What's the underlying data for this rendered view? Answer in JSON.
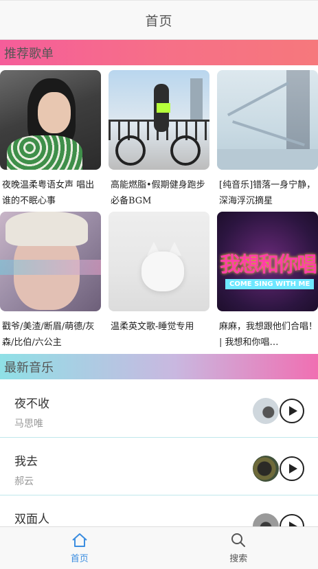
{
  "header": {
    "title": "首页"
  },
  "sections": {
    "recommend_title": "推荐歌单",
    "latest_title": "最新音乐"
  },
  "playlists": [
    {
      "title": "夜晚温柔粤语女声 唱出谁的不眠心事"
    },
    {
      "title": "高能燃脂•假期健身跑步必备BGM"
    },
    {
      "title": "[纯音乐]错落一身宁静，深海浮沉摘星"
    },
    {
      "title": "戳爷/美渣/断眉/萌德/灰森/比伯/六公主"
    },
    {
      "title": "温柔英文歌-睡觉专用"
    },
    {
      "title": "麻麻，我想跟他们合唱！|  我想和你唱…"
    }
  ],
  "cover_text": {
    "sing_title": "我想和你唱",
    "sing_subtitle": "COME SING WITH ME"
  },
  "songs": [
    {
      "name": "夜不收",
      "artist": "马思唯"
    },
    {
      "name": "我去",
      "artist": "郝云"
    },
    {
      "name": "双面人",
      "artist": ""
    }
  ],
  "tabbar": {
    "home_label": "首页",
    "search_label": "搜索",
    "home_icon": "home-icon",
    "search_icon": "search-icon",
    "active_color": "#3b8de0"
  },
  "colors": {
    "recommend_gradient": [
      "#f55d9a",
      "#f6787c"
    ],
    "latest_gradient": [
      "#8fe0e6",
      "#f06fb2"
    ]
  }
}
